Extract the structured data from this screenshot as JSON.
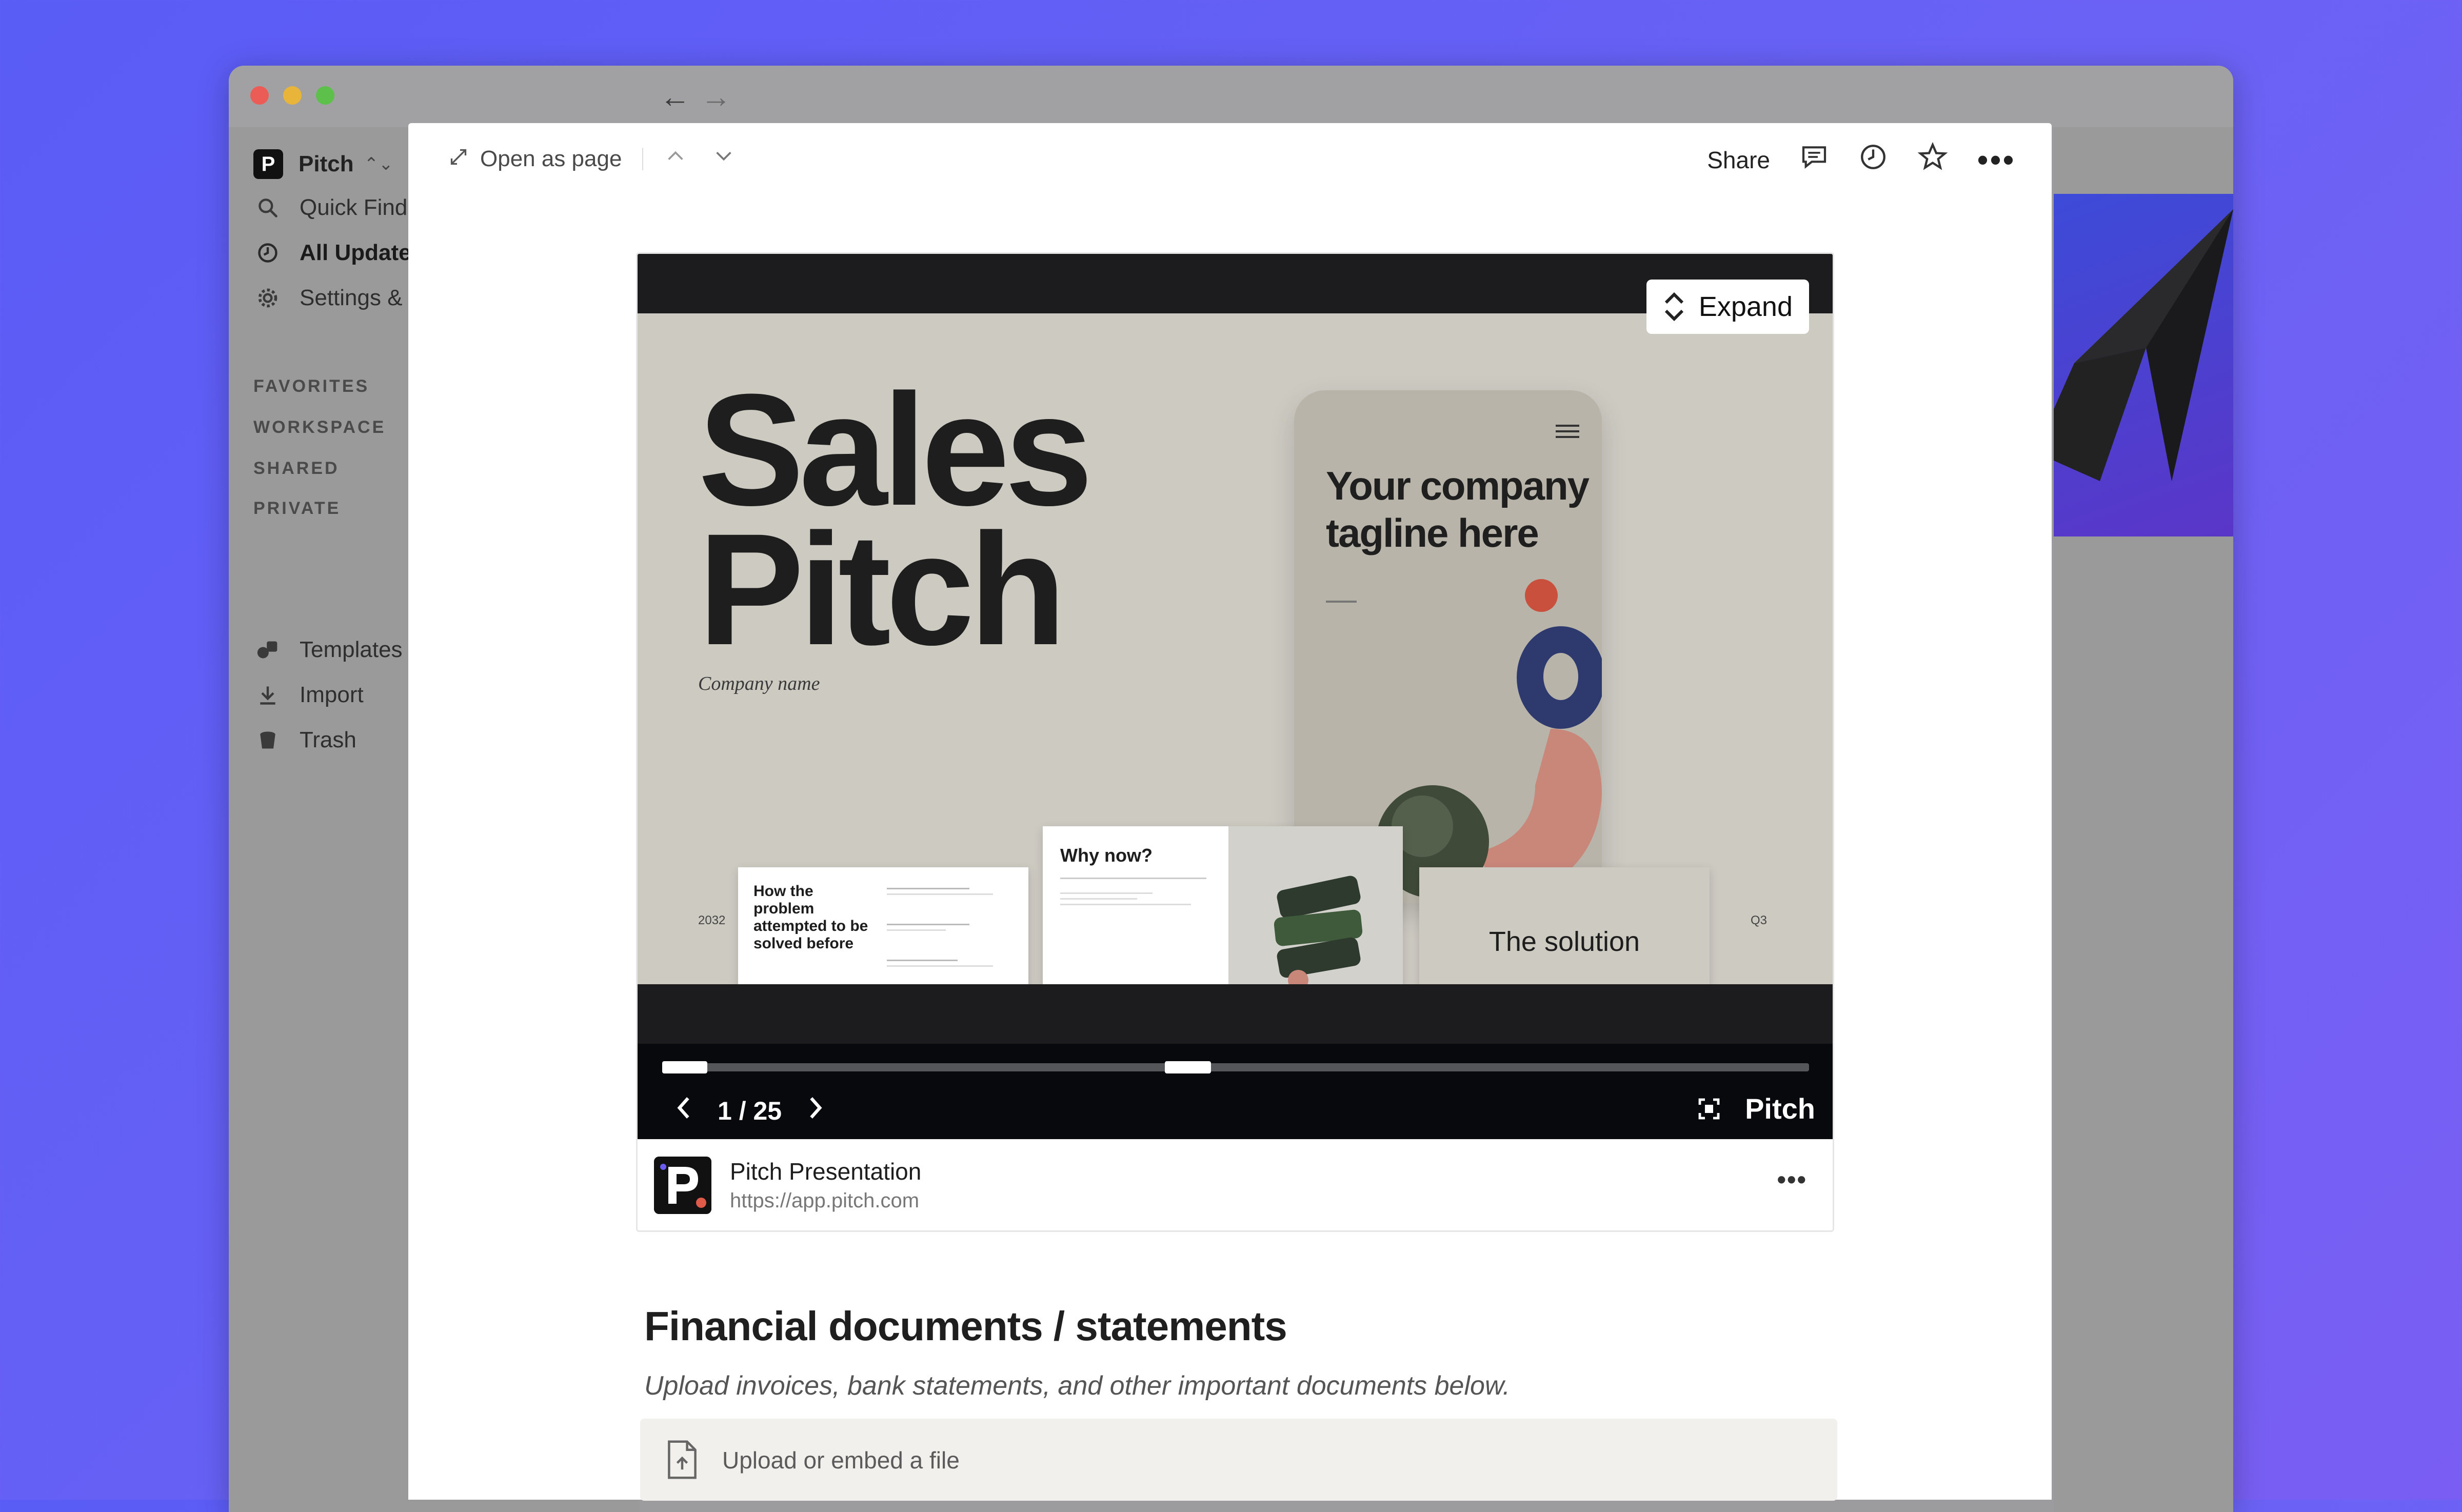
{
  "app": {
    "workspace_name": "Pitch",
    "workspace_logo_letter": "P"
  },
  "sidebar": {
    "items": [
      {
        "label": "Quick Find",
        "icon": "search-icon"
      },
      {
        "label": "All Updates",
        "icon": "clock-icon"
      },
      {
        "label": "Settings & members",
        "icon": "gear-icon"
      }
    ],
    "sections": [
      "FAVORITES",
      "WORKSPACE",
      "SHARED",
      "PRIVATE"
    ],
    "bottom_items": [
      {
        "label": "Templates",
        "icon": "templates-icon"
      },
      {
        "label": "Import",
        "icon": "download-icon"
      },
      {
        "label": "Trash",
        "icon": "trash-icon"
      }
    ]
  },
  "modal": {
    "open_as_page": "Open as page",
    "share": "Share"
  },
  "embed": {
    "expand_label": "Expand",
    "slide": {
      "title_line1": "Sales",
      "title_line2": "Pitch",
      "company": "Company name",
      "tagline_line1": "Your company",
      "tagline_line2": "tagline here",
      "year_left": "2032",
      "year_right": "Q3",
      "thumb1_title": "How the problem attempted to be solved before",
      "thumb2_title": "Why now?",
      "thumb3_title": "The solution"
    },
    "pager": "1 / 25",
    "progress_fraction": 0.04,
    "brand": "Pitch",
    "title": "Pitch Presentation",
    "url": "https://app.pitch.com"
  },
  "doc": {
    "heading": "Financial documents / statements",
    "subtitle": "Upload invoices, bank statements, and other important documents below.",
    "upload_label": "Upload or embed a file"
  }
}
